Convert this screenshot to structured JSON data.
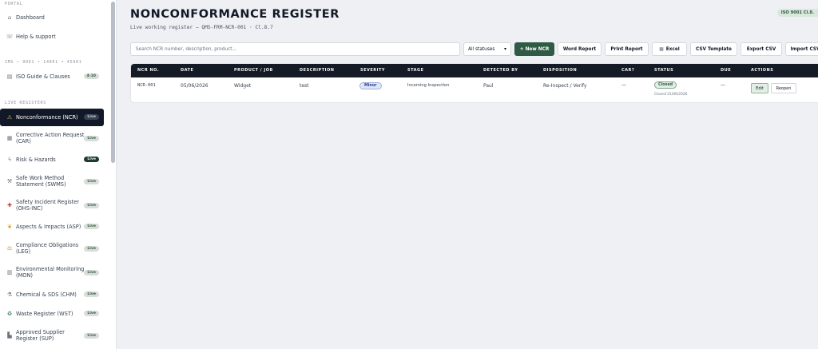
{
  "sidebar": {
    "portal_label": "PORTAL",
    "portal_items": [
      {
        "label": "Dashboard",
        "icon": "dashboard-icon"
      },
      {
        "label": "Help & support",
        "icon": "help-icon"
      }
    ],
    "ims_label": "IMS — 9001 • 14001 • 45001",
    "ims_items": [
      {
        "label": "ISO Guide & Clauses",
        "icon": "book-icon",
        "badge": "4-10"
      }
    ],
    "live_label": "LIVE REGISTERS",
    "live_items": [
      {
        "label": "Nonconformance (NCR)",
        "badge": "Live"
      },
      {
        "label": "Corrective Action Request (CAR)",
        "badge": "Live"
      },
      {
        "label": "Risk & Hazards",
        "badge": "Live"
      },
      {
        "label": "Safe Work Method Statement (SWMS)",
        "badge": "Live"
      },
      {
        "label": "Safety Incident Register (OHS-INC)",
        "badge": "Live"
      },
      {
        "label": "Aspects & Impacts (ASP)",
        "badge": "Live"
      },
      {
        "label": "Compliance Obligations (LEG)",
        "badge": "Live"
      },
      {
        "label": "Environmental Monitoring (MON)",
        "badge": "Live"
      },
      {
        "label": "Chemical & SDS (CHM)",
        "badge": "Live"
      },
      {
        "label": "Waste Register (WST)",
        "badge": "Live"
      },
      {
        "label": "Approved Supplier Register (SUP)",
        "badge": "Live"
      }
    ]
  },
  "header": {
    "title": "NONCONFORMANCE REGISTER",
    "subtitle": "Live working register — QMS-FRM-NCR-001 · Cl.8.7",
    "iso_badge": "ISO 9001 Cl.8."
  },
  "toolbar": {
    "search_placeholder": "Search NCR number, description, product...",
    "status_select": "All statuses",
    "new_ncr": "+ New NCR",
    "word_report": "Word Report",
    "print_report": "Print Report",
    "excel": "Excel",
    "csv_template": "CSV Template",
    "export_csv": "Export CSV",
    "import_csv": "Import CSV"
  },
  "table": {
    "headers": {
      "ncr_no": "NCR NO.",
      "date": "DATE",
      "product": "PRODUCT / JOB",
      "description": "DESCRIPTION",
      "severity": "SEVERITY",
      "stage": "STAGE",
      "detected_by": "DETECTED BY",
      "disposition": "DISPOSITION",
      "car": "CAR?",
      "status": "STATUS",
      "due": "DUE",
      "actions": "ACTIONS"
    },
    "rows": [
      {
        "ncr_no": "NCR-001",
        "date": "05/06/2026",
        "product": "Widget",
        "description": "test",
        "severity": "Minor",
        "stage": "Incoming Inspection",
        "detected_by": "Paul",
        "disposition": "Re-Inspect / Verify",
        "car": "—",
        "status": "Closed",
        "closed_on": "Closed 21/06/2026",
        "due": "—",
        "edit": "Edit",
        "reopen": "Reopen"
      }
    ]
  },
  "colors": {
    "accent": "#2f5b45",
    "sidebar_active": "#111827",
    "table_header": "#141b26"
  }
}
